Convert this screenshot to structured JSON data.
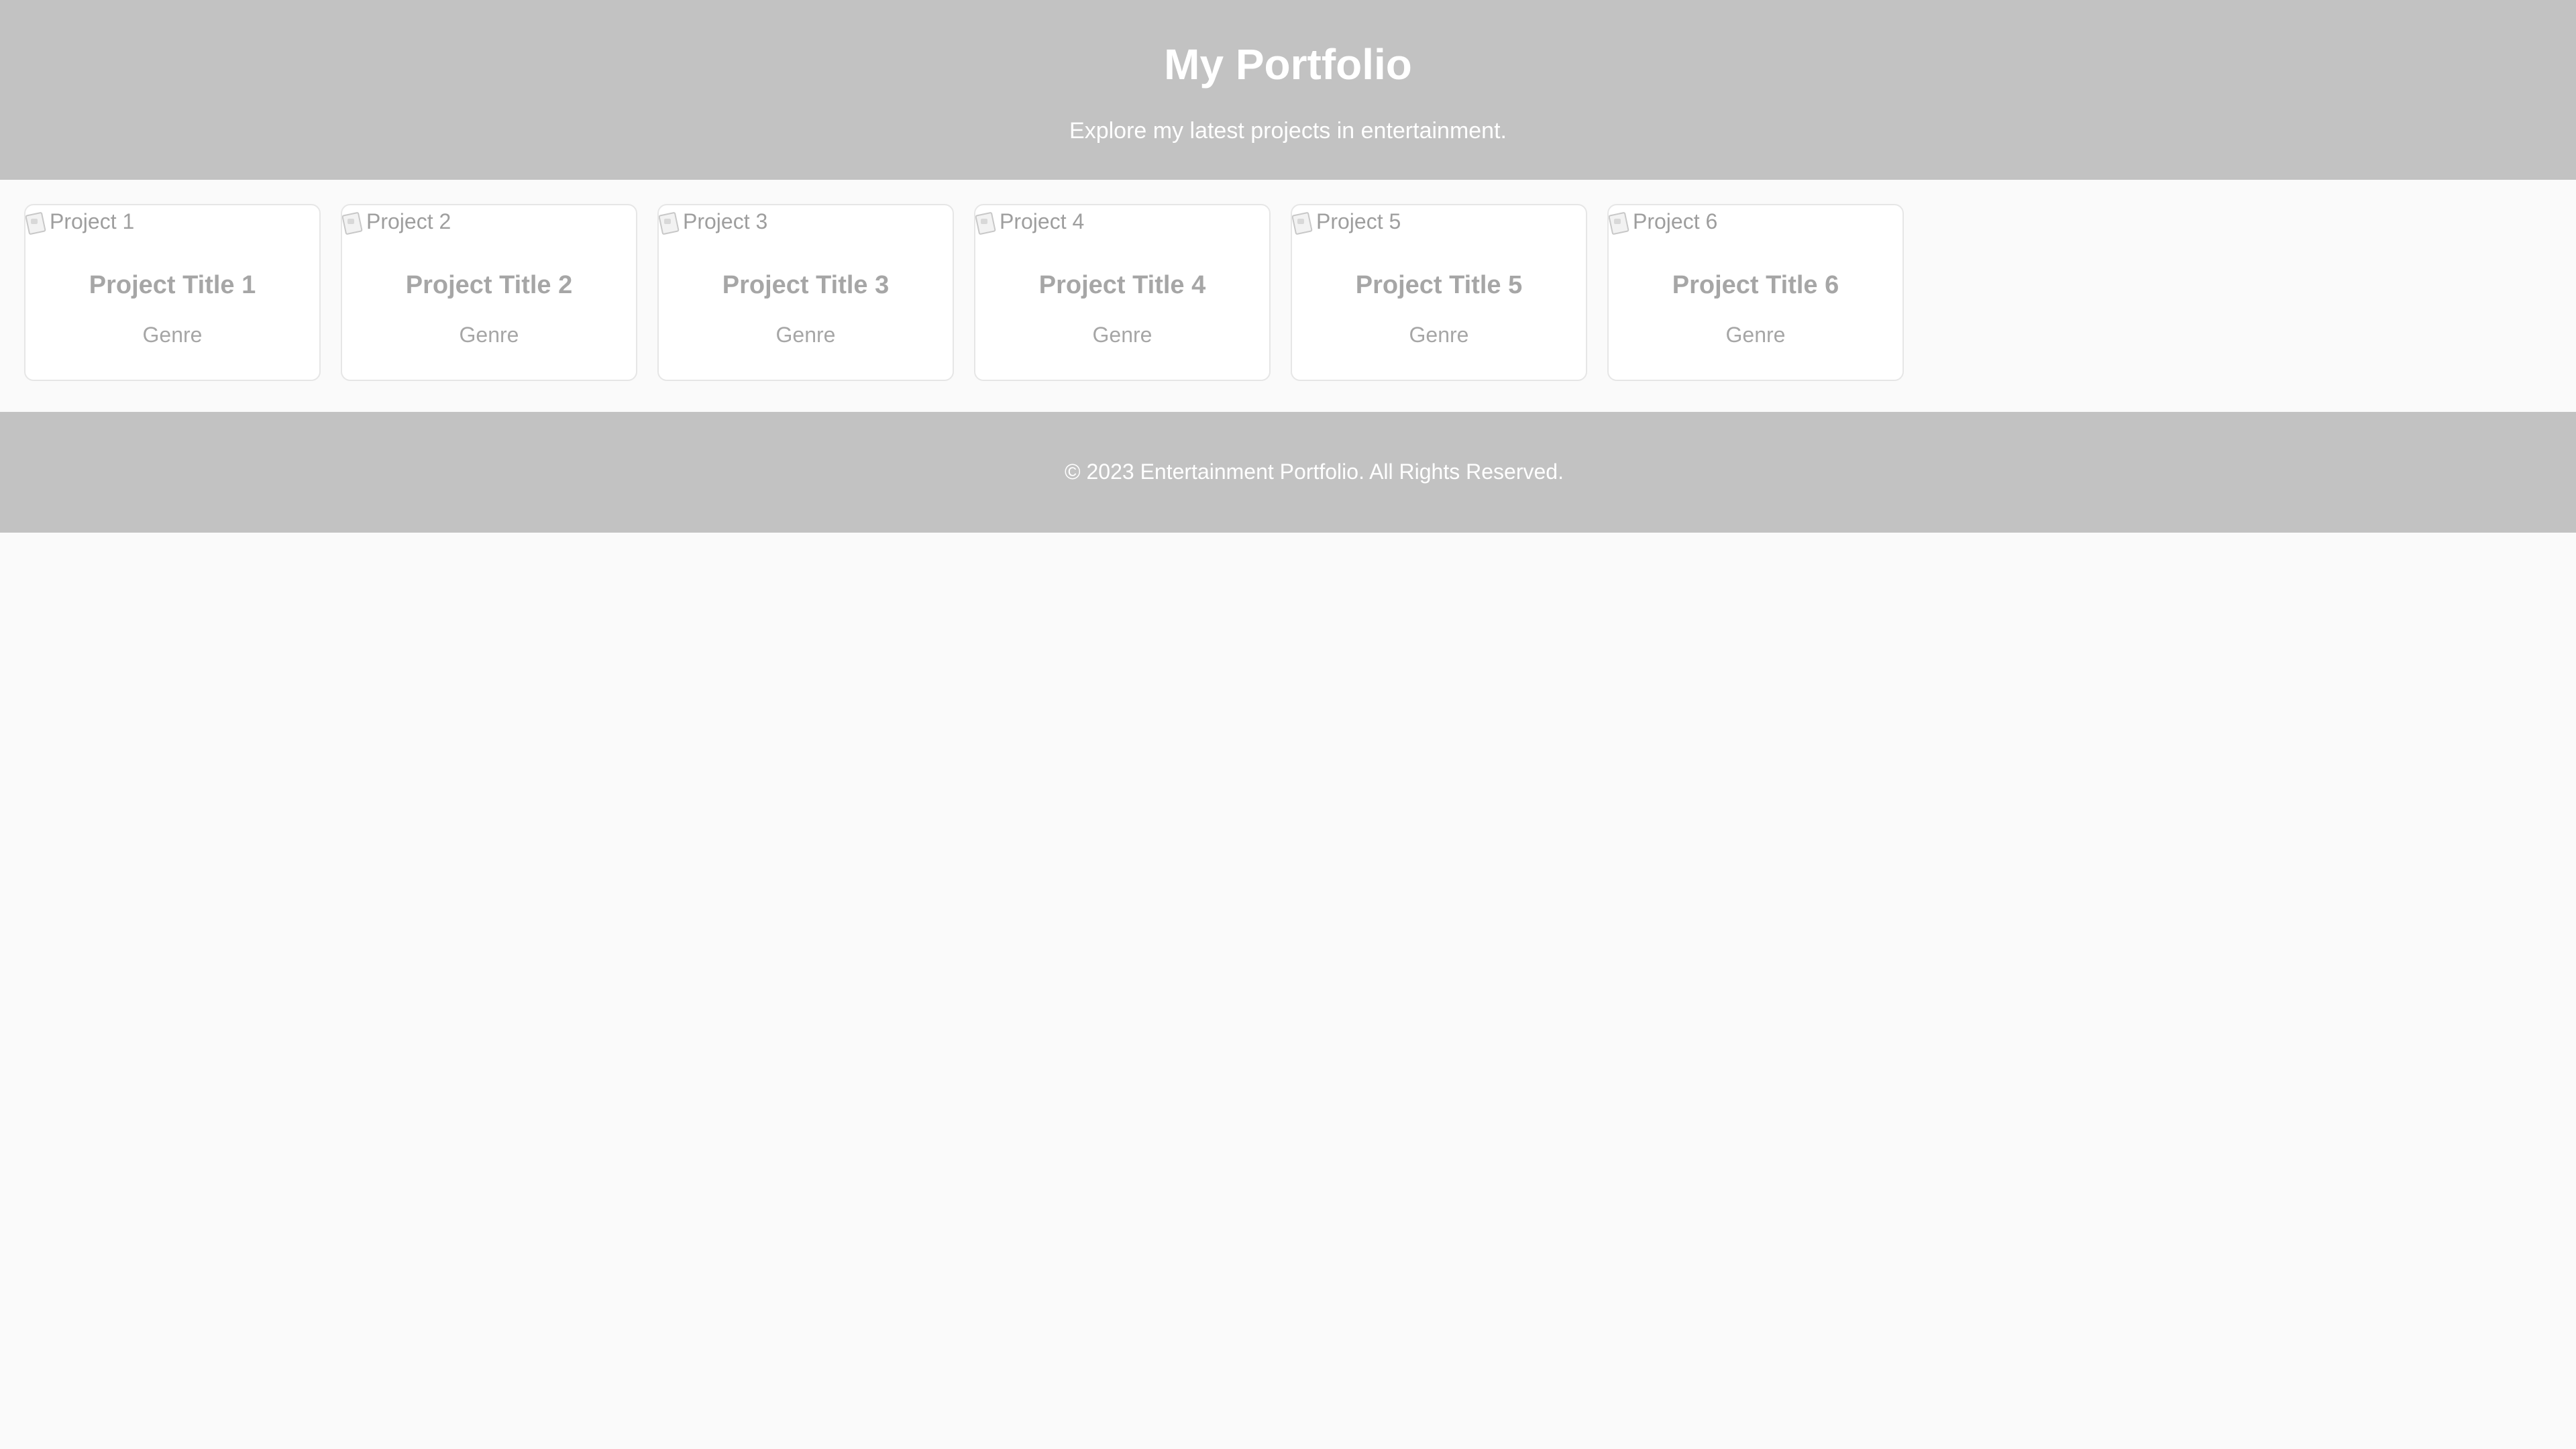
{
  "header": {
    "title": "My Portfolio",
    "subtitle": "Explore my latest projects in entertainment."
  },
  "projects": [
    {
      "image_alt": "Project 1",
      "title": "Project Title 1",
      "genre": "Genre"
    },
    {
      "image_alt": "Project 2",
      "title": "Project Title 2",
      "genre": "Genre"
    },
    {
      "image_alt": "Project 3",
      "title": "Project Title 3",
      "genre": "Genre"
    },
    {
      "image_alt": "Project 4",
      "title": "Project Title 4",
      "genre": "Genre"
    },
    {
      "image_alt": "Project 5",
      "title": "Project Title 5",
      "genre": "Genre"
    },
    {
      "image_alt": "Project 6",
      "title": "Project Title 6",
      "genre": "Genre"
    }
  ],
  "footer": {
    "text": "© 2023 Entertainment Portfolio. All Rights Reserved."
  },
  "colors": {
    "header_bg": "#c2c2c2",
    "page_bg": "#fafafa",
    "card_bg": "#ffffff",
    "muted_text": "#a6a6a6"
  }
}
